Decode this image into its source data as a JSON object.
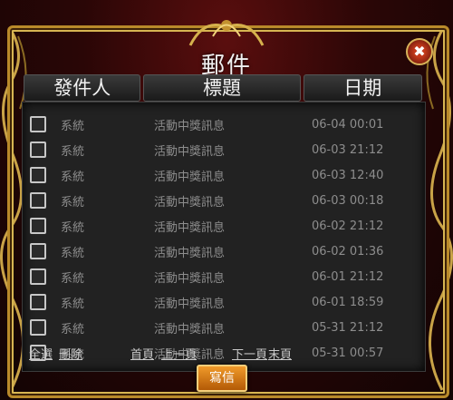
{
  "window": {
    "title": "郵件"
  },
  "columns": {
    "sender": "發件人",
    "subject": "標題",
    "date": "日期"
  },
  "mails": [
    {
      "sender": "系統",
      "subject": "活動中獎訊息",
      "date": "06-04 00:01"
    },
    {
      "sender": "系統",
      "subject": "活動中獎訊息",
      "date": "06-03 21:12"
    },
    {
      "sender": "系統",
      "subject": "活動中獎訊息",
      "date": "06-03 12:40"
    },
    {
      "sender": "系統",
      "subject": "活動中獎訊息",
      "date": "06-03 00:18"
    },
    {
      "sender": "系統",
      "subject": "活動中獎訊息",
      "date": "06-02 21:12"
    },
    {
      "sender": "系統",
      "subject": "活動中獎訊息",
      "date": "06-02 01:36"
    },
    {
      "sender": "系統",
      "subject": "活動中獎訊息",
      "date": "06-01 21:12"
    },
    {
      "sender": "系統",
      "subject": "活動中獎訊息",
      "date": "06-01 18:59"
    },
    {
      "sender": "系統",
      "subject": "活動中獎訊息",
      "date": "05-31 21:12"
    },
    {
      "sender": "系統",
      "subject": "活動中獎訊息",
      "date": "05-31 00:57"
    }
  ],
  "pager": {
    "select_all": "全選",
    "delete": "刪除",
    "first": "首頁",
    "prev": "上一頁",
    "next": "下一頁",
    "last": "末頁"
  },
  "buttons": {
    "write": "寫信",
    "close_icon": "close-icon"
  },
  "colors": {
    "gold": "#d7b552",
    "accent_red": "#5a0e0e",
    "button_orange": "#f09a2a"
  }
}
